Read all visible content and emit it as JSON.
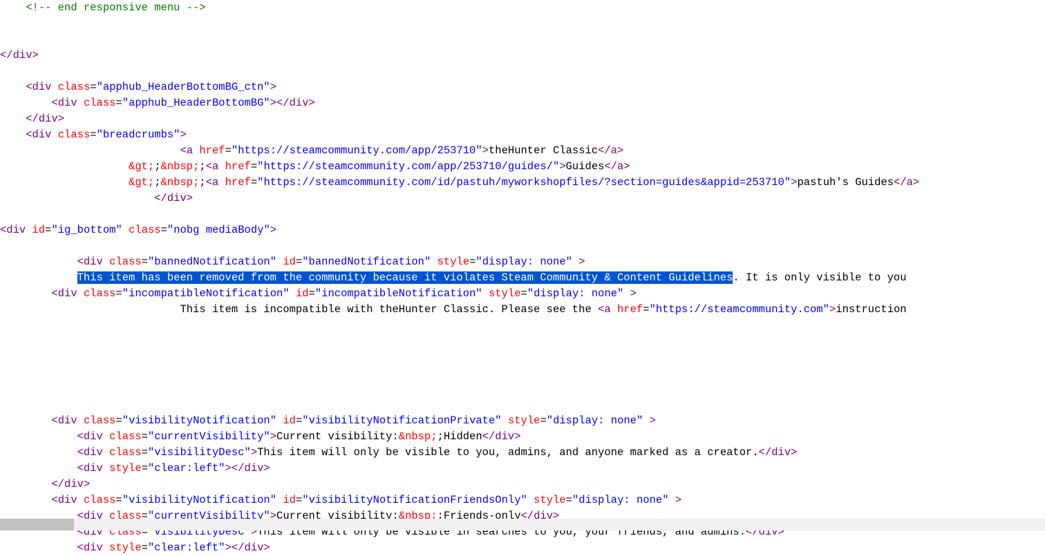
{
  "comment_end_responsive": "<!-- end responsive menu -->",
  "close_div": "</div>",
  "apphub_open": "<div class=\"apphub_HeaderBottomBG_ctn\">",
  "apphub_inner": "<div class=\"apphub_HeaderBottomBG\"></div>",
  "breadcrumbs_open": "<div class=\"breadcrumbs\">",
  "bc_link1_open": "<a href=\"https://steamcommunity.com/app/253710\">",
  "bc_link1_text": "theHunter Classic",
  "bc_link1_close": "</a>",
  "gt_nbsp": "&gt;&nbsp;",
  "bc_link2_open": "<a href=\"https://steamcommunity.com/app/253710/guides/\">",
  "bc_link2_text": "Guides",
  "bc_link3_open": "<a href=\"https://steamcommunity.com/id/pastuh/myworkshopfiles/?section=guides&appid=253710\">",
  "bc_link3_text": "pastuh's Guides",
  "ig_bottom_open": "<div id=\"ig_bottom\" class=\"nobg mediaBody\">",
  "banned_open": "<div class=\"bannedNotification\" id=\"bannedNotification\" style=\"display: none\" >",
  "banned_selected": "This item has been removed from the community because it violates Steam Community & Content Guidelines",
  "banned_trail": ". It is only visible to you",
  "incompat_open": "<div class=\"incompatibleNotification\" id=\"incompatibleNotification\" style=\"display: none\" >",
  "incompat_text1": "This item is incompatible with theHunter Classic. Please see the ",
  "incompat_a_open": "<a href=\"https://steamcommunity.com\">",
  "incompat_text2": "instruction",
  "vis_priv_open": "<div class=\"visibilityNotification\" id=\"visibilityNotificationPrivate\" style=\"display: none\" >",
  "vis_curr_open": "<div class=\"currentVisibility\">",
  "vis_priv_text": "Current visibility:&nbsp;Hidden",
  "vis_desc_open": "<div class=\"visibilityDesc\">",
  "vis_priv_desc": "This item will only be visible to you, admins, and anyone marked as a creator.",
  "clear_left": "<div style=\"clear:left\"></div>",
  "vis_friends_open": "<div class=\"visibilityNotification\" id=\"visibilityNotificationFriendsOnly\" style=\"display: none\" >",
  "vis_friends_text": "Current visibility:&nbsp;Friends-only",
  "vis_friends_desc": "This item will only be visible in searches to you, your friends, and admins."
}
